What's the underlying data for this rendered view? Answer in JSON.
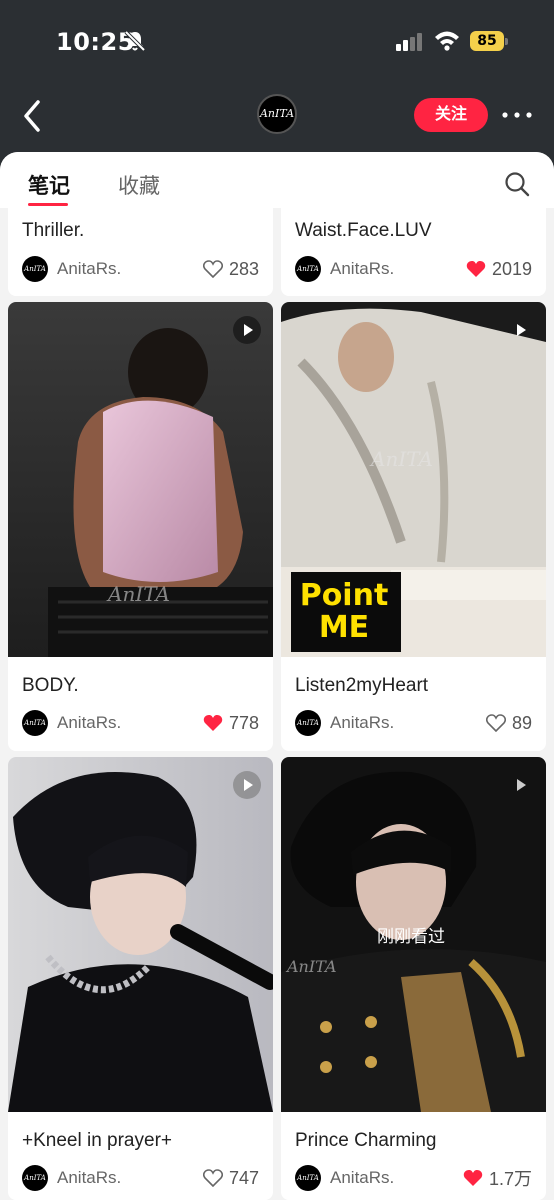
{
  "status_bar": {
    "time": "10:25",
    "battery": "85"
  },
  "header": {
    "avatar_text": "AnITA",
    "follow_label": "关注"
  },
  "tabs": [
    {
      "label": "笔记"
    },
    {
      "label": "收藏"
    }
  ],
  "cards": [
    {
      "title": "Thriller.",
      "author": "AnitaRs.",
      "likes": "283",
      "liked": false
    },
    {
      "title": "Waist.Face.LUV",
      "author": "AnitaRs.",
      "likes": "2019",
      "liked": true
    },
    {
      "title": "BODY.",
      "author": "AnitaRs.",
      "likes": "778",
      "liked": true,
      "video": true
    },
    {
      "title": "Listen2myHeart",
      "author": "AnitaRs.",
      "likes": "89",
      "liked": false,
      "video": true,
      "sticker": "Point ME"
    },
    {
      "title": "+Kneel in prayer+",
      "author": "AnitaRs.",
      "likes": "747",
      "liked": false,
      "video": true
    },
    {
      "title": "Prince Charming",
      "author": "AnitaRs.",
      "likes": "1.7万",
      "liked": true,
      "video": true,
      "viewed_label": "刚刚看过"
    }
  ],
  "colors": {
    "accent": "#ff2442",
    "background": "#f3f3f3",
    "header_bg": "#2b2f33"
  }
}
